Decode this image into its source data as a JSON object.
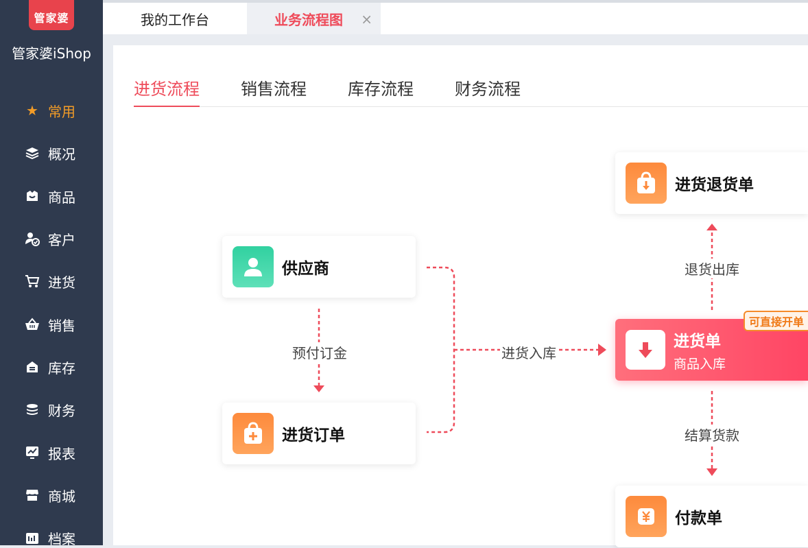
{
  "sidebar": {
    "logo_text": "管家婆",
    "brand": "管家婆iShop",
    "items": [
      {
        "label": "常用",
        "icon": "star-icon"
      },
      {
        "label": "概况",
        "icon": "layers-icon"
      },
      {
        "label": "商品",
        "icon": "product-icon"
      },
      {
        "label": "客户",
        "icon": "customer-icon"
      },
      {
        "label": "进货",
        "icon": "cart-icon"
      },
      {
        "label": "销售",
        "icon": "basket-icon"
      },
      {
        "label": "库存",
        "icon": "warehouse-icon"
      },
      {
        "label": "财务",
        "icon": "coins-icon"
      },
      {
        "label": "报表",
        "icon": "chart-icon"
      },
      {
        "label": "商城",
        "icon": "store-icon"
      },
      {
        "label": "档案",
        "icon": "archive-icon"
      }
    ]
  },
  "tabs": {
    "home": "我的工作台",
    "active": "业务流程图",
    "close": "×"
  },
  "subtabs": [
    "进货流程",
    "销售流程",
    "库存流程",
    "财务流程"
  ],
  "flow": {
    "supplier": "供应商",
    "purchase_order": "进货订单",
    "purchase_return": "进货退货单",
    "purchase": "进货单",
    "purchase_sub": "商品入库",
    "badge": "可直接开单",
    "payment": "付款单",
    "label_prepay": "预付订金",
    "label_instock": "进货入库",
    "label_return": "退货出库",
    "label_settle": "结算货款"
  },
  "colors": {
    "accent": "#ee4b5a",
    "sidebar": "#2f3a4e",
    "active_nav": "#f39c27"
  }
}
